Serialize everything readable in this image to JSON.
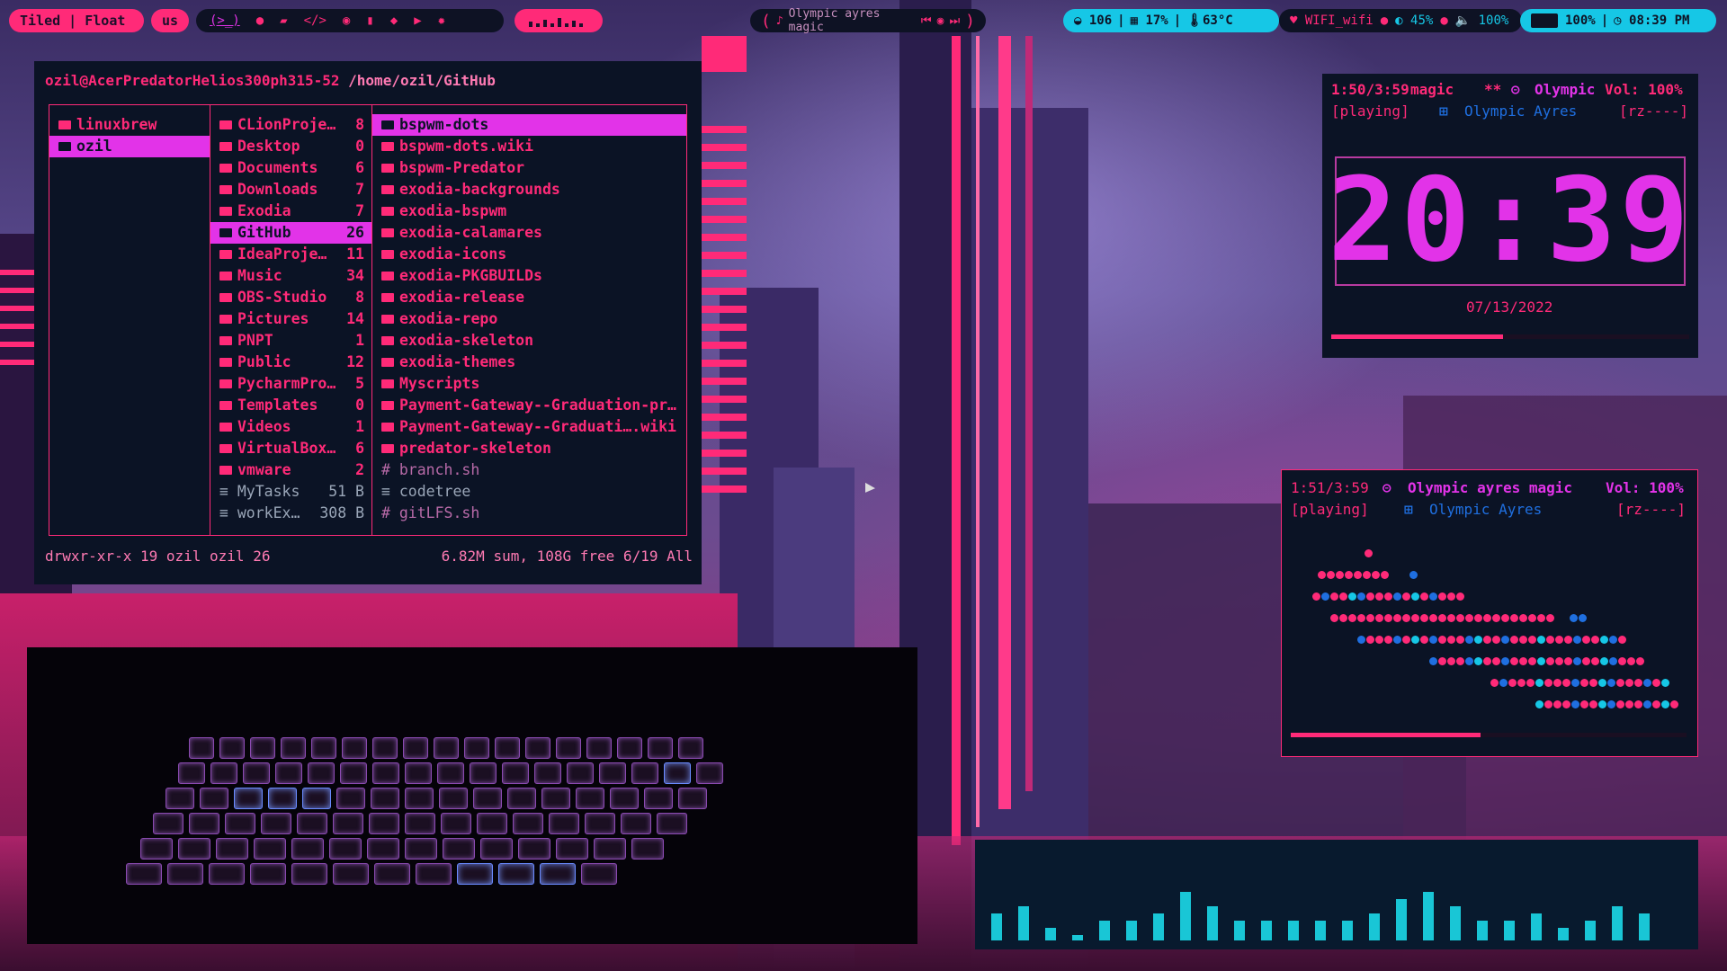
{
  "bar": {
    "layout": "Tiled | Float",
    "keyboard": "us",
    "now_playing": "Olympic ayres magic",
    "cpu_count": "106",
    "cpu_usage": "17%",
    "temperature": "63°C",
    "wifi": "WIFI_wifi",
    "brightness": "45%",
    "volume": "100%",
    "battery": "100%",
    "time": "08:39 PM"
  },
  "ranger": {
    "title_user": "ozil@AcerPredatorHelios300ph315-52",
    "title_path": "/home/ozil/GitHub",
    "col1": [
      {
        "name": "linuxbrew",
        "selected": false
      },
      {
        "name": "ozil",
        "selected": true
      }
    ],
    "col2": [
      {
        "name": "CLionProje…",
        "count": "8",
        "type": "dir"
      },
      {
        "name": "Desktop",
        "count": "0",
        "type": "dir"
      },
      {
        "name": "Documents",
        "count": "6",
        "type": "dir"
      },
      {
        "name": "Downloads",
        "count": "7",
        "type": "dir"
      },
      {
        "name": "Exodia",
        "count": "7",
        "type": "dir"
      },
      {
        "name": "GitHub",
        "count": "26",
        "type": "dir",
        "selected": true
      },
      {
        "name": "IdeaProje…",
        "count": "11",
        "type": "dir"
      },
      {
        "name": "Music",
        "count": "34",
        "type": "dir"
      },
      {
        "name": "OBS-Studio",
        "count": "8",
        "type": "dir"
      },
      {
        "name": "Pictures",
        "count": "14",
        "type": "dir"
      },
      {
        "name": "PNPT",
        "count": "1",
        "type": "dir"
      },
      {
        "name": "Public",
        "count": "12",
        "type": "dir"
      },
      {
        "name": "PycharmPro…",
        "count": "5",
        "type": "dir"
      },
      {
        "name": "Templates",
        "count": "0",
        "type": "dir"
      },
      {
        "name": "Videos",
        "count": "1",
        "type": "video"
      },
      {
        "name": "VirtualBox…",
        "count": "6",
        "type": "dir"
      },
      {
        "name": "vmware",
        "count": "2",
        "type": "dir"
      },
      {
        "name": "MyTasks",
        "count": "51 B",
        "type": "file"
      },
      {
        "name": "workEx…",
        "count": "308 B",
        "type": "file"
      }
    ],
    "col3": [
      {
        "name": "bspwm-dots",
        "type": "dir",
        "selected": true
      },
      {
        "name": "bspwm-dots.wiki",
        "type": "dir"
      },
      {
        "name": "bspwm-Predator",
        "type": "dir"
      },
      {
        "name": "exodia-backgrounds",
        "type": "dir"
      },
      {
        "name": "exodia-bspwm",
        "type": "dir"
      },
      {
        "name": "exodia-calamares",
        "type": "dir"
      },
      {
        "name": "exodia-icons",
        "type": "dir"
      },
      {
        "name": "exodia-PKGBUILDs",
        "type": "dir"
      },
      {
        "name": "exodia-release",
        "type": "dir"
      },
      {
        "name": "exodia-repo",
        "type": "dir"
      },
      {
        "name": "exodia-skeleton",
        "type": "dir"
      },
      {
        "name": "exodia-themes",
        "type": "dir"
      },
      {
        "name": "Myscripts",
        "type": "dir"
      },
      {
        "name": "Payment-Gateway--Graduation-pr…",
        "type": "dir"
      },
      {
        "name": "Payment-Gateway--Graduati….wiki",
        "type": "dir"
      },
      {
        "name": "predator-skeleton",
        "type": "dir"
      },
      {
        "name": "branch.sh",
        "type": "script"
      },
      {
        "name": "codetree",
        "type": "file"
      },
      {
        "name": "gitLFS.sh",
        "type": "script"
      }
    ],
    "status_left": "drwxr-xr-x 19 ozil ozil 26",
    "status_right": "6.82M sum, 108G free  6/19  All"
  },
  "clock_panel": {
    "position": "1:50/3:59",
    "song": "magic",
    "flags": "**",
    "artist": "Olympic",
    "volume": "Vol: 100%",
    "state": "[playing]",
    "album": "Olympic Ayres",
    "mode": "[rz----]",
    "clock": "20:39",
    "date": "07/13/2022",
    "progress": 0.48
  },
  "music_panel": {
    "position": "1:51/3:59",
    "song": "Olympic ayres magic",
    "volume": "Vol: 100%",
    "state": "[playing]",
    "album": "Olympic Ayres",
    "mode": "[rz----]",
    "progress": 0.48
  },
  "visualizer": {
    "levels": [
      3,
      4,
      1,
      0,
      2,
      2,
      3,
      6,
      4,
      2,
      2,
      2,
      2,
      2,
      3,
      5,
      6,
      4,
      2,
      2,
      3,
      1,
      2,
      4,
      3
    ]
  },
  "colors": {
    "accent": "#ff2a78",
    "magenta": "#e233e8",
    "cyan": "#16c7e6",
    "panel_bg": "#0b1325"
  }
}
